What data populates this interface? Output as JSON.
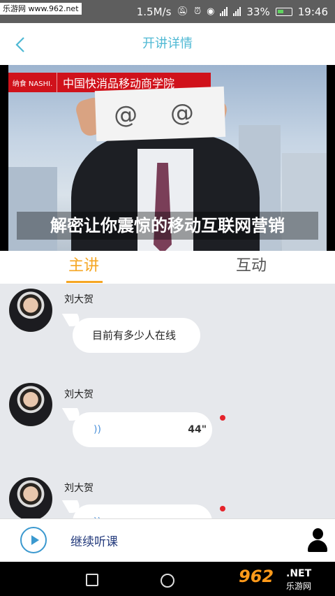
{
  "status_bar": {
    "watermark": "乐游网 www.962.net",
    "speed": "1.5M/s",
    "network_2g": "2G",
    "network_4g": "4G",
    "battery_percent": "33%",
    "time": "19:46"
  },
  "header": {
    "title": "开讲详情"
  },
  "banner": {
    "brand_logo": "纳食 NASHI.",
    "brand_text": "中国快消品移动商学院",
    "paper_text": "@ @",
    "caption": "解密让你震惊的移动互联网营销"
  },
  "tabs": [
    {
      "label": "主讲",
      "active": true
    },
    {
      "label": "互动",
      "active": false
    }
  ],
  "messages": [
    {
      "sender": "刘大贺",
      "type": "text",
      "text": "目前有多少人在线"
    },
    {
      "sender": "刘大贺",
      "type": "voice",
      "voice_icon": "))",
      "duration": "44\"",
      "unread": true
    },
    {
      "sender": "刘大贺",
      "type": "voice",
      "voice_icon": "))",
      "duration": "",
      "unread": true
    }
  ],
  "bottom_bar": {
    "continue_label": "继续听课"
  },
  "nav_bar": {
    "logo_number": "962",
    "logo_net": ".NET",
    "logo_cn": "乐游网"
  },
  "colors": {
    "accent_blue": "#4fb9d4",
    "tab_active": "#f5a623",
    "continue_text": "#233a7c",
    "unread_dot": "#e5232b"
  }
}
